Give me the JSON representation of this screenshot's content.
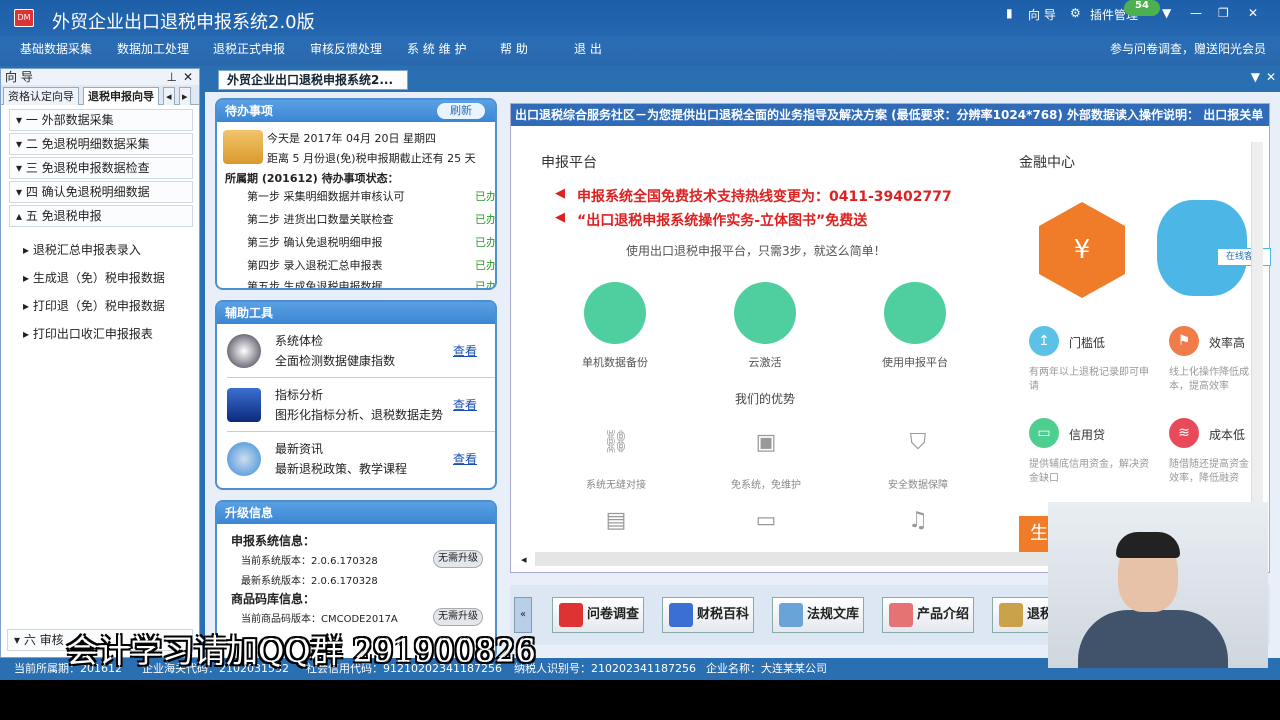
{
  "app": {
    "title": "外贸企业出口退税申报系统2.0版",
    "badge": "54",
    "guide": "向 导",
    "plugin": "插件管理"
  },
  "menu": [
    "基础数据采集",
    "数据加工处理",
    "退税正式申报",
    "审核反馈处理",
    "系 统 维 护",
    "帮 助",
    "退 出"
  ],
  "survey": "参与问卷调查，赠送阳光会员",
  "left": {
    "header": "向 导",
    "tabs": [
      "资格认定向导",
      "退税申报向导"
    ],
    "steps": [
      "一  外部数据采集",
      "二  免退税明细数据采集",
      "三  免退税申报数据检查",
      "四  确认免退税明细数据",
      "五  免退税申报"
    ],
    "subs": [
      "退税汇总申报表录入",
      "生成退（免）税申报数据",
      "打印退（免）税申报数据",
      "打印出口收汇申报报表"
    ],
    "bottom_step": "六  审核"
  },
  "doctab": "外贸企业出口退税申报系统2...",
  "todo": {
    "title": "待办事项",
    "refresh": "刷新",
    "today": "今天是  2017年 04月 20日 星期四",
    "deadline": "距离 5 月份退(免)税申报期截止还有 25 天",
    "period": "所属期 (201612) 待办事项状态：",
    "rows": [
      {
        "t": "第一步  采集明细数据并审核认可",
        "s": "已办"
      },
      {
        "t": "第二步  进货出口数量关联检查",
        "s": "已办"
      },
      {
        "t": "第三步  确认免退税明细申报",
        "s": "已办"
      },
      {
        "t": "第四步  录入退税汇总申报表",
        "s": "已办"
      },
      {
        "t": "第五步  生成免退税申报数据",
        "s": "已办"
      }
    ]
  },
  "tools": {
    "title": "辅助工具",
    "items": [
      {
        "t": "系统体检",
        "d": "全面检测数据健康指数",
        "l": "查看"
      },
      {
        "t": "指标分析",
        "d": "图形化指标分析、退税数据走势",
        "l": "查看"
      },
      {
        "t": "最新资讯",
        "d": "最新退税政策、教学课程",
        "l": "查看"
      }
    ]
  },
  "upgrade": {
    "title": "升级信息",
    "sys_label": "申报系统信息：",
    "cur_ver": "当前系统版本：2.0.6.170328",
    "new_ver": "最新系统版本：2.0.6.170328",
    "btn": "无需升级",
    "goods_label": "商品码库信息：",
    "goods_ver": "当前商品码版本：CMCODE2017A",
    "goods_btn": "无需升级"
  },
  "ticker": "出口退税综合服务社区－为您提供出口退税全面的业务指导及解决方案 (最低要求：分辨率1024*768) 外部数据读入操作说明： 出口报关单",
  "platform": {
    "title": "申报平台",
    "hot1": "申报系统全国免费技术支持热线变更为：0411-39402777",
    "hot2": "“出口退税申报系统操作实务-立体图书”免费送",
    "slogan": "使用出口退税申报平台，只需3步，就这么简单！",
    "big": [
      "单机数据备份",
      "云激活",
      "使用申报平台"
    ],
    "adv_title": "我们的优势",
    "adv": [
      "系统无缝对接",
      "免系统，免维护",
      "安全数据保障"
    ]
  },
  "finance": {
    "title": "金融中心",
    "online": "在线客服",
    "items": [
      {
        "t": "门槛低",
        "d": "有两年以上退税记录即可申请"
      },
      {
        "t": "效率高",
        "d": "线上化操作降低成本，提高效率"
      },
      {
        "t": "信用贷",
        "d": "提供辅底信用资金，解决资金缺口"
      },
      {
        "t": "成本低",
        "d": "随借随还提高资金效率，降低融资"
      }
    ],
    "block": "生"
  },
  "bottom_tools": [
    "问卷调查",
    "财税百科",
    "法规文库",
    "产品介绍",
    "退税"
  ],
  "status": {
    "period": "当前所属期：201612",
    "customs": "企业海关代码：2102031532",
    "credit": "社会信用代码：91210202341187256",
    "tax": "纳税人识别号：210202341187256",
    "company": "企业名称：大连某某公司"
  },
  "overlay": "会计学习请加QQ群 291900826",
  "colors": {
    "titlebar": "#2466b0",
    "panel_border": "#4d8fd1",
    "done": "#2a9d2a",
    "hotline": "#d22222",
    "accent_green": "#4fcf9f"
  }
}
